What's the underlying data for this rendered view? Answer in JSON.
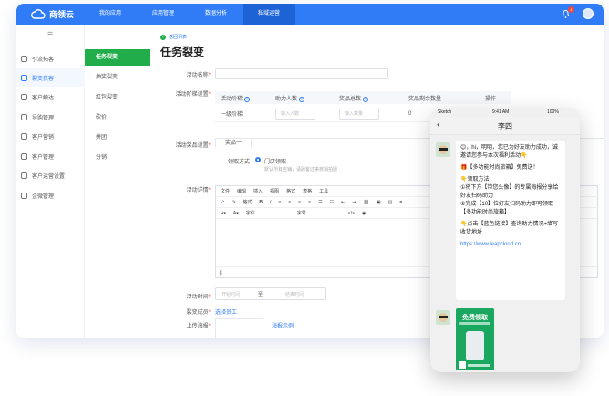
{
  "app": {
    "logo_text": "商领云"
  },
  "topnav": {
    "items": [
      {
        "label": "我的应用"
      },
      {
        "label": "应用管理"
      },
      {
        "label": "数据分析"
      },
      {
        "label": "私域运营"
      }
    ],
    "active_index": 3,
    "notification_count": "1"
  },
  "sidebar": {
    "collapse_icon": "collapse-icon",
    "items": [
      {
        "label": "引流拓客",
        "icon": "funnel-icon"
      },
      {
        "label": "裂变获客",
        "icon": "share-icon"
      },
      {
        "label": "客户触达",
        "icon": "send-icon"
      },
      {
        "label": "导购管理",
        "icon": "user-icon"
      },
      {
        "label": "客户营销",
        "icon": "megaphone-icon"
      },
      {
        "label": "客户管理",
        "icon": "customer-icon"
      },
      {
        "label": "客户运营设置",
        "icon": "settings-icon"
      },
      {
        "label": "企微管理",
        "icon": "wecom-icon"
      }
    ],
    "active_index": 1
  },
  "submenu": {
    "items": [
      {
        "label": "任务裂变"
      },
      {
        "label": "抽奖裂变"
      },
      {
        "label": "红包裂变"
      },
      {
        "label": "砍价"
      },
      {
        "label": "拼团"
      },
      {
        "label": "分销"
      }
    ],
    "active_index": 0
  },
  "page": {
    "back_label": "返回列表",
    "title": "任务裂变"
  },
  "form": {
    "activity_name_label": "活动名称",
    "ladder_label": "活动阶梯设置",
    "ladder_table": {
      "headers": [
        "活动阶梯",
        "助力人数",
        "奖品总数",
        "奖品剩余数量",
        "操作"
      ],
      "row": {
        "level": "一级阶梯",
        "helpers_placeholder": "输入人数",
        "total_placeholder": "输入数量",
        "remaining": "0"
      }
    },
    "prize_label": "活动奖品设置",
    "prize_tab": "奖品一",
    "claim_method_label": "领取方式",
    "claim_method_value": "门店领取",
    "claim_hint": "默认所有店铺，请顾客过来核销拍摄",
    "detail_label": "活动详情",
    "editor": {
      "menu": [
        "文件",
        "编辑",
        "插入",
        "视图",
        "格式",
        "表格",
        "工具"
      ],
      "format_label": "格式",
      "font_label": "字体",
      "size_label": "字号",
      "footer": "p"
    },
    "time_label": "活动时间",
    "time_start_placeholder": "开始时间",
    "time_separator": "至",
    "time_end_placeholder": "结束时间",
    "member_label": "裂变成员",
    "member_link": "选择员工",
    "poster_label": "上传海报",
    "poster_link": "海报示例"
  },
  "phone": {
    "carrier": "Sketch",
    "time": "9:41 AM",
    "battery": "100%",
    "contact": "李四",
    "message": {
      "line1": "😊，hi，明明，您已为好友助力成功，诚邀请您参与本次福利活动👇",
      "line2": "🎁【多功能时尚旅箱】免费送！",
      "line3": "👇领取方法",
      "line4": "①将下方【带您头像】的专属海报分享给好友扫码助力",
      "line5": "②完成【10】位好友扫码助力即可领取【多功能时尚旅箱】",
      "line6": "👇点击【蓝色链接】查询助力情况+填写收货地址",
      "url": "https://www.leapcloud.cn"
    },
    "poster_title": "免费领取"
  }
}
